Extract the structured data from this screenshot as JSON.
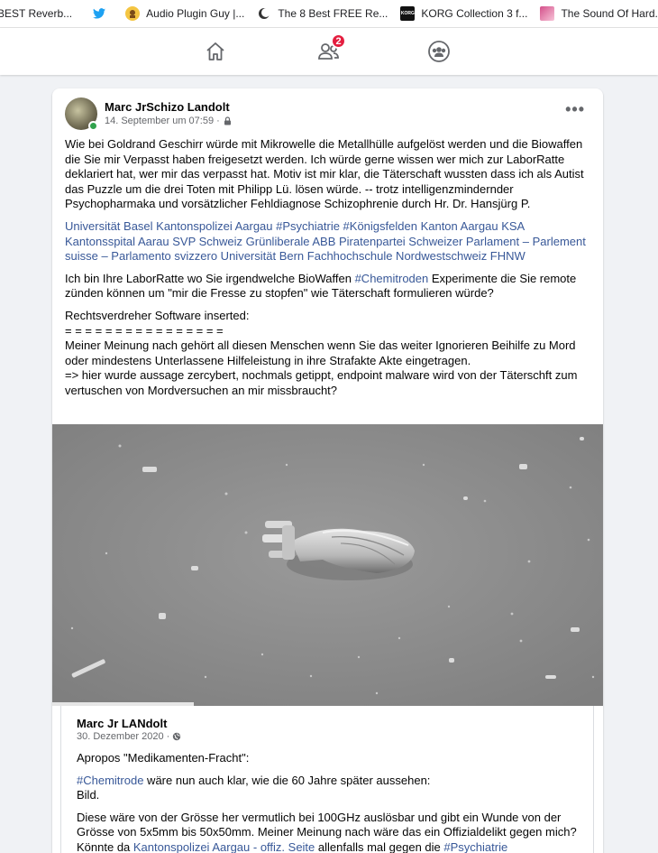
{
  "bookmarks": [
    {
      "label": "BEST Reverb...",
      "icon": "generic-icon"
    },
    {
      "label": "",
      "icon": "twitter-icon"
    },
    {
      "label": "Audio Plugin Guy |...",
      "icon": "audio-plugin-guy-icon"
    },
    {
      "label": "The 8 Best FREE Re...",
      "icon": "moon-icon"
    },
    {
      "label": "KORG Collection 3 f...",
      "icon": "korg-icon"
    },
    {
      "label": "The Sound Of Hard...",
      "icon": "sound-icon"
    }
  ],
  "nav": {
    "friends_badge": "2"
  },
  "post": {
    "author": "Marc JrSchizo Landolt",
    "date": "14. September um 07:59 ·",
    "more": "•••",
    "para1": "Wie bei Goldrand Geschirr würde mit Mikrowelle die Metallhülle aufgelöst werden und die Biowaffen die Sie mir Verpasst haben freigesetzt werden. Ich würde gerne wissen wer mich zur LaborRatte deklariert hat, wer mir das verpasst hat. Motiv ist mir klar, die Täterschaft wussten dass ich als Autist das Puzzle um die drei Toten mit Philipp Lü. lösen würde. -- trotz intelligenzmindernder Psychopharmaka und vorsätzlicher Fehldiagnose Schizophrenie durch Hr. Dr. Hansjürg P.",
    "links": "Universität Basel Kantonspolizei Aargau #Psychiatrie #Königsfelden Kanton Aargau KSA Kantonsspital Aarau SVP Schweiz Grünliberale ABB Piratenpartei Schweizer Parlament – Parlement suisse – Parlamento svizzero Universität Bern Fachhochschule Nordwestschweiz FHNW",
    "para3_before": "Ich bin Ihre LaborRatte wo Sie irgendwelche BioWaffen ",
    "para3_link": "#Chemitroden",
    "para3_after": " Experimente die Sie remote zünden können um \"mir die Fresse zu stopfen\" wie Täterschaft formulieren würde?",
    "para4_line1": "Rechtsverdreher Software inserted:",
    "para4_line2": "= = = = = = = = = = = = = = = =",
    "para4_line3": "Meiner Meinung nach gehört all diesen Menschen wenn Sie das weiter Ignorieren Beihilfe zu Mord oder mindestens Unterlassene Hilfeleistung in ihre Strafakte Akte eingetragen.",
    "para4_line4": "=> hier wurde aussage zercybert, nochmals getippt, endpoint malware wird von der Täterschft zum vertuschen von Mordversuchen an mir missbraucht?"
  },
  "shared": {
    "author": "Marc Jr LANdolt",
    "date": "30. Dezember 2020 ·",
    "p1": "Apropos \"Medikamenten-Fracht\":",
    "p2_link": "#Chemitrode",
    "p2_after": " wäre nun auch klar, wie die 60 Jahre später aussehen:",
    "p2_line2": "Bild.",
    "p3_before": "Diese wäre von der Grösse her vermutlich bei 100GHz auslösbar und gibt ein Wunde von der Grösse von 5x5mm bis 50x50mm. Meiner Meinung nach wäre das ein Offizialdelikt gegen mich? Könnte da ",
    "p3_link1": "Kantonspolizei Aargau - offiz. Seite",
    "p3_mid": " allenfalls mal gegen die ",
    "p3_link2": "#Psychiatrie"
  },
  "colors": {
    "link": "#385898",
    "badge": "#e41e3f",
    "online": "#31a24c",
    "page_bg": "#f0f2f5"
  }
}
